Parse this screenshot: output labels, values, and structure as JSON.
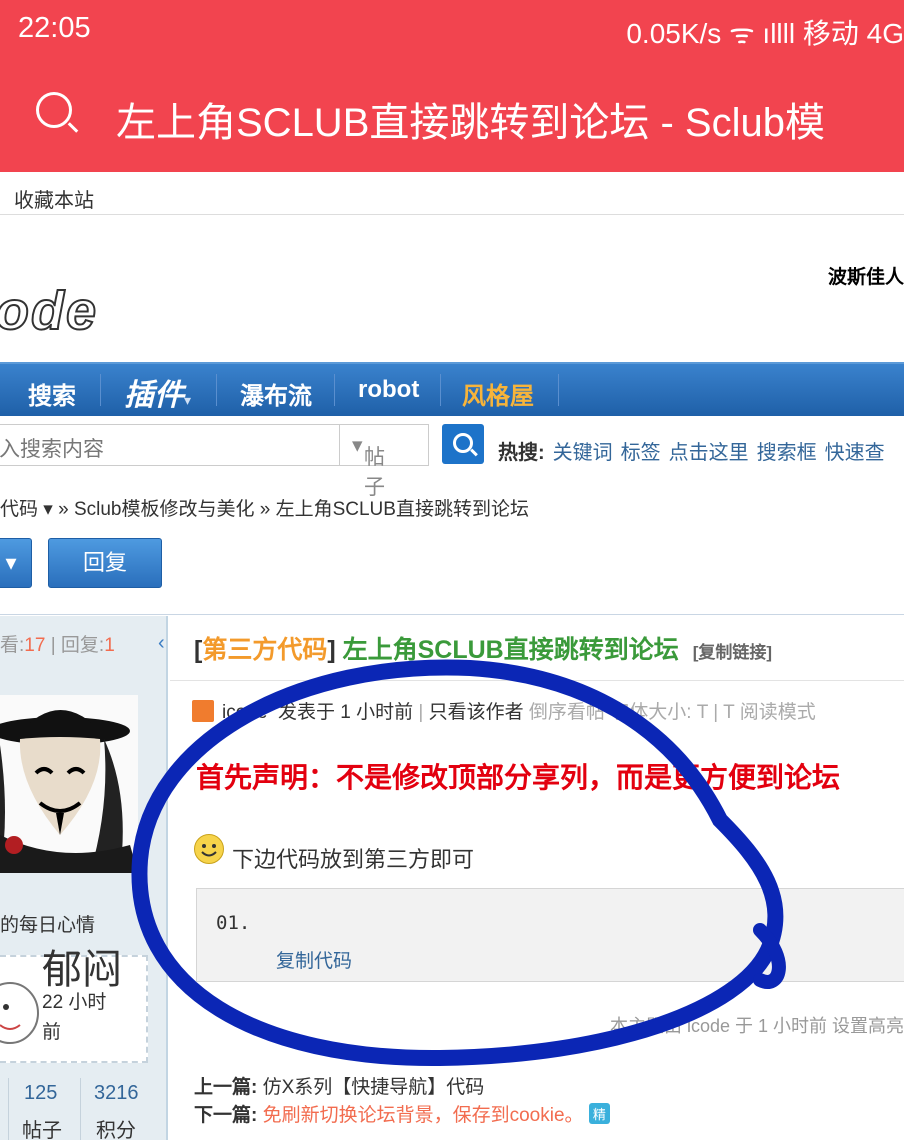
{
  "status": {
    "time": "22:05",
    "right": "0.05K/s  ᯤ  ıllll  移动  4G"
  },
  "browser": {
    "title": "左上角SCLUB直接跳转到论坛 - Sclub模"
  },
  "site": {
    "fav": "收藏本站",
    "ad": "波斯佳人",
    "logo": "ode"
  },
  "nav": {
    "items": [
      "搜索",
      "插件",
      "瀑布流",
      "robot",
      "风格屋"
    ]
  },
  "search": {
    "placeholder": "入搜索内容",
    "type": "帖子",
    "hot_label": "热搜:",
    "hot": [
      "关键词",
      "标签",
      "点击这里",
      "搜索框",
      "快速查"
    ]
  },
  "breadcrumb": "代码 ▾  » Sclub模板修改与美化 » 左上角SCLUB直接跳转到论坛",
  "buttons": {
    "reply": "回复"
  },
  "stats": {
    "views_label": "看:",
    "views": "17",
    "sep": " | ",
    "replies_label": "回复:",
    "replies": "1"
  },
  "author": {
    "mood_label": "的每日心情",
    "mood": "郁闷",
    "mood_time": "22 小时前",
    "posts": "125",
    "posts_label": "帖子",
    "points": "3216",
    "points_label": "积分"
  },
  "post": {
    "category": "第三方代码",
    "title": "左上角SCLUB直接跳转到论坛",
    "copy_link": "[复制链接]",
    "meta": {
      "author": "icode",
      "time": "发表于 1 小时前",
      "only": "只看该作者",
      "order": "倒序看帖",
      "font": "字体大小: T | T",
      "read": "阅读模式"
    },
    "declare": "首先声明：不是修改顶部分享列，而是更方便到论坛",
    "line": "下边代码放到第三方即可",
    "code_line": "01.",
    "copy_code": "复制代码",
    "highlight": "本主题由 icode 于 1 小时前 设置高亮"
  },
  "prevnext": {
    "prev_label": "上一篇:",
    "prev": "仿X系列【快捷导航】代码",
    "next_label": "下一篇:",
    "next": "免刷新切换论坛背景，保存到cookie。",
    "badge": "精"
  }
}
